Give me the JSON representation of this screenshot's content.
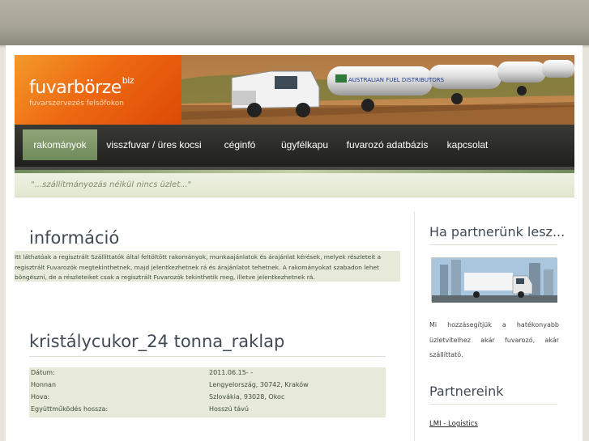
{
  "logo": {
    "name": "fuvarbörze",
    "suffix": "biz",
    "tagline": "fuvarszervezés felsőfokon"
  },
  "nav": {
    "items": [
      {
        "label": "rakományok",
        "active": true
      },
      {
        "label": "visszfuvar / üres kocsi",
        "active": false
      },
      {
        "label": "céginfó",
        "active": false
      },
      {
        "label": "ügyfélkapu",
        "active": false
      },
      {
        "label": "fuvarozó adatbázis",
        "active": false
      },
      {
        "label": "kapcsolat",
        "active": false
      }
    ]
  },
  "slogan": "\"...szállítmányozás nélkül nincs üzlet...\"",
  "banner": {
    "truck_text": "AUSTRALIAN FUEL DISTRIBUTORS"
  },
  "info": {
    "title": "információ",
    "text": "Itt láthatóak a regisztrált Szállíttatók által feltöltött rakományok, munkaajánlatok és árajánlat kérések, melyek részleteit a regisztrált Fuvarozók megtekinthetnek, majd jelentkezhetnek rá és árajánlatot tehetnek. A rakományokat szabadon lehet böngészni, de a részleteiket csak a regisztrált Fuvarozók tekinthetik meg, illetve jelentkezhetnek rá."
  },
  "listing": {
    "title": "kristálycukor_24 tonna_raklap",
    "rows": [
      {
        "label": "Dátum:",
        "value": "2011.06.15- -"
      },
      {
        "label": "Honnan",
        "value": "Lengyelország, 30742, Kraków"
      },
      {
        "label": "Hova:",
        "value": "Szlovákia, 93028, Okoc"
      },
      {
        "label": "Együttműködés hossza:",
        "value": "Hosszú távú"
      }
    ]
  },
  "sidebar": {
    "partner_title": "Ha partnerünk lesz...",
    "partner_text": "Mi hozzásegítjük a hatékonyabb üzletvitelhez akár fuvarozó, akár szállíttató.",
    "partners_title": "Partnereink",
    "partners": [
      "LMI - Logistics"
    ]
  },
  "colors": {
    "accent": "#ee6a12",
    "nav_active": "#7d966a",
    "nav_bg": "#2a2a26"
  }
}
